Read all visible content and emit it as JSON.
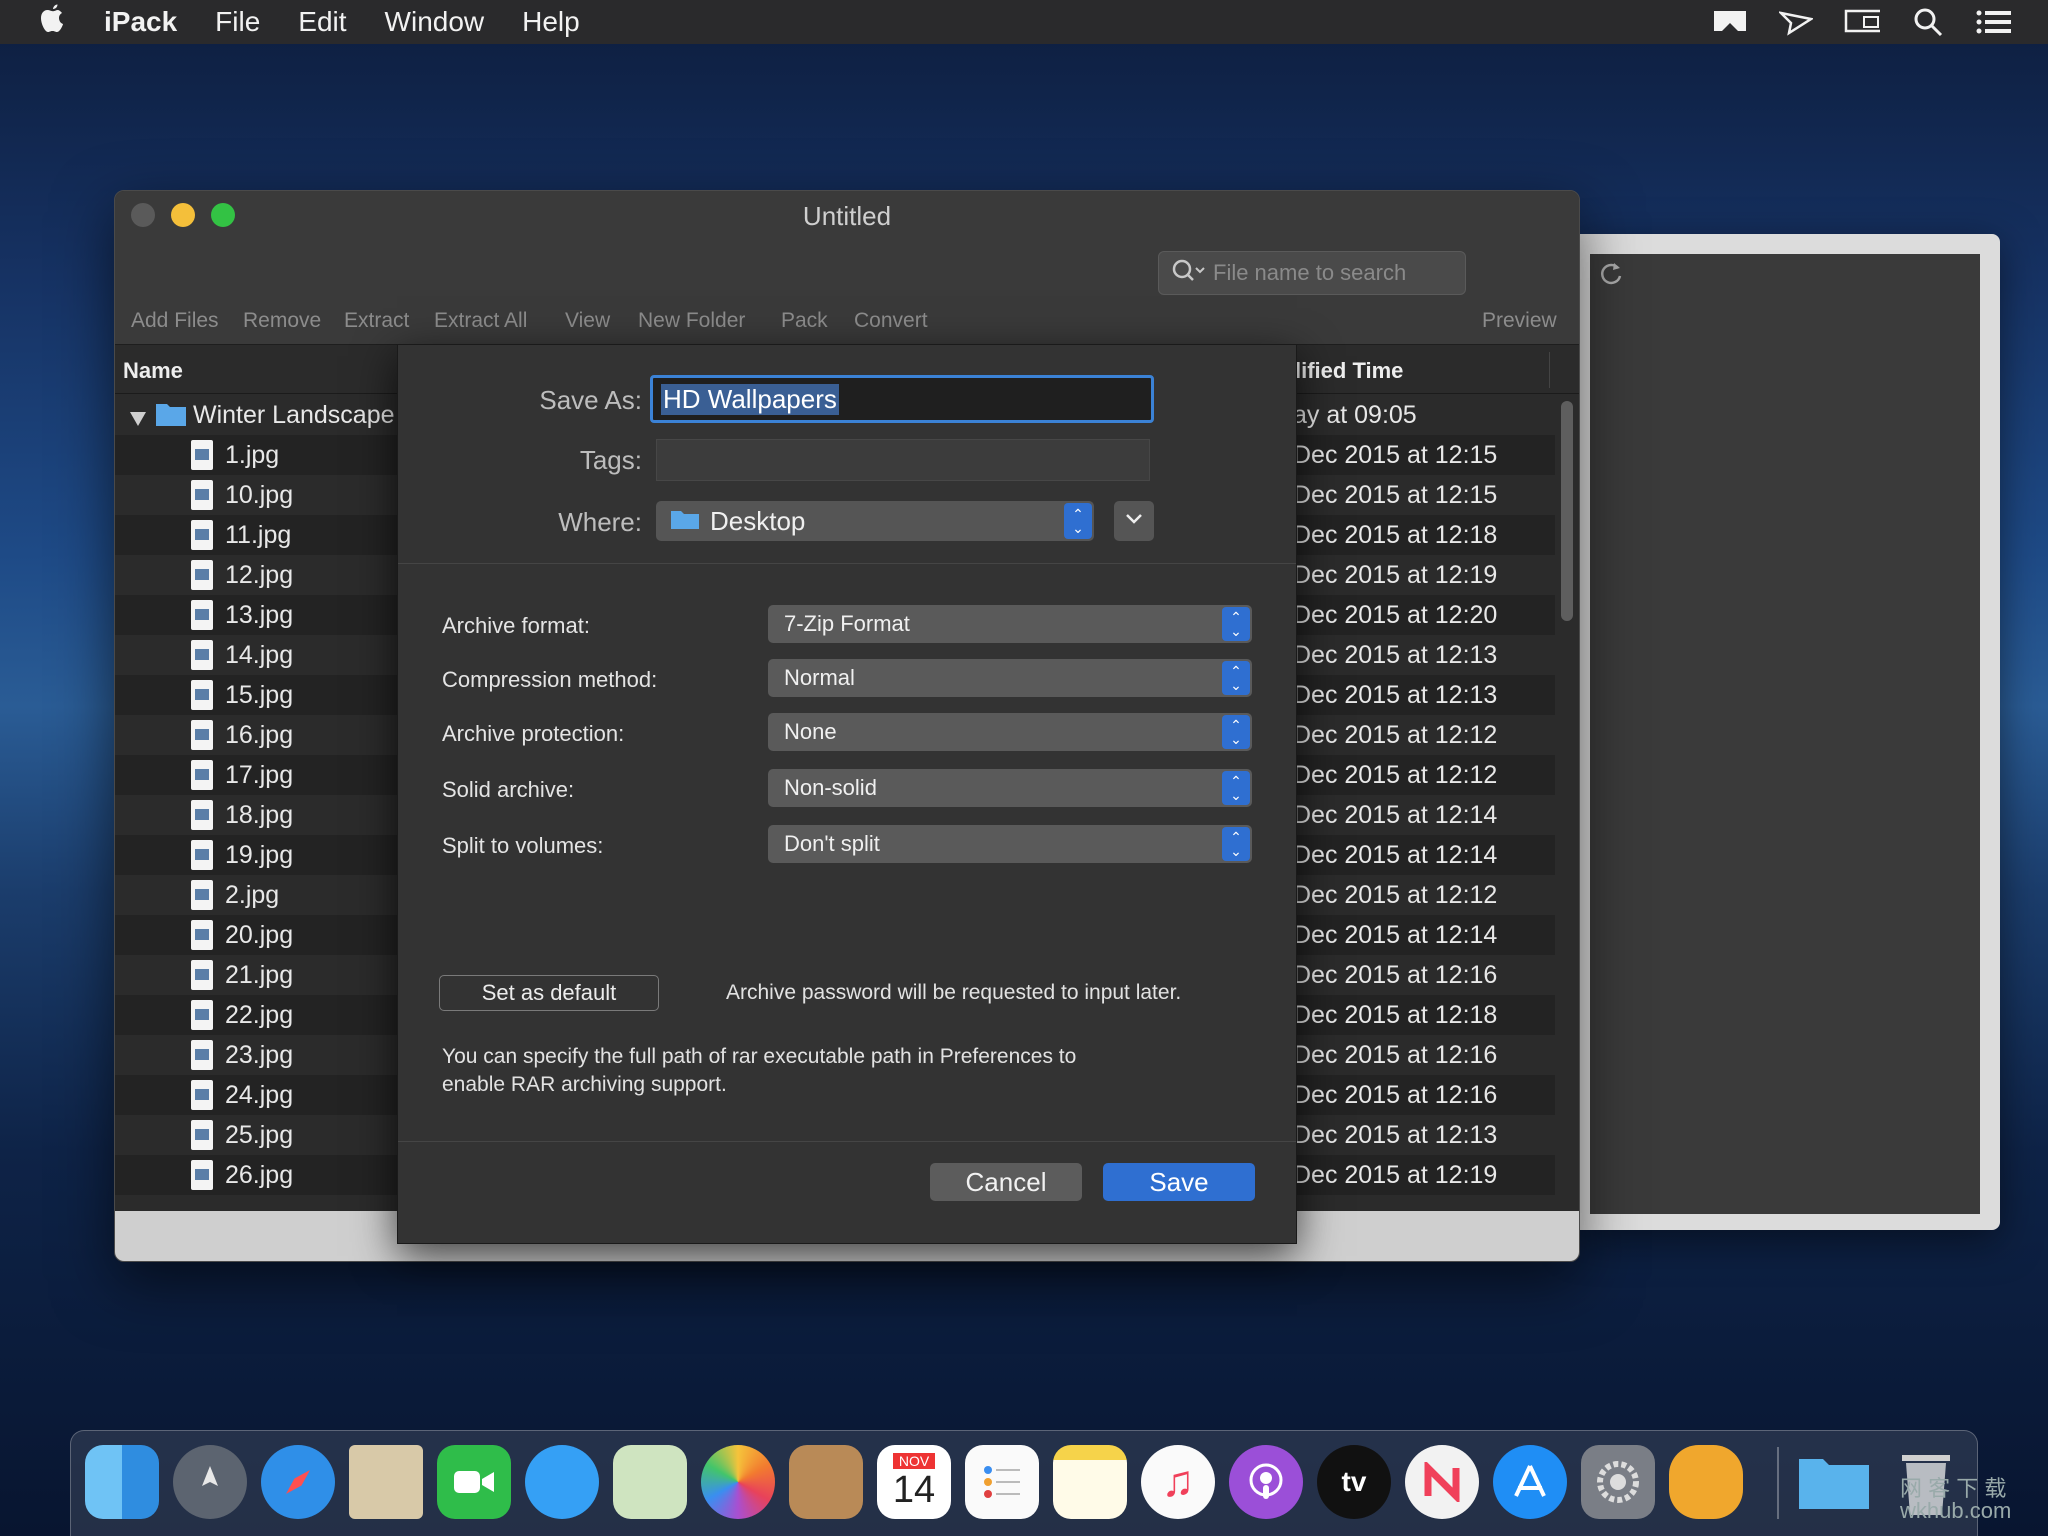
{
  "menubar": {
    "app": "iPack",
    "items": [
      "File",
      "Edit",
      "Window",
      "Help"
    ]
  },
  "window": {
    "title": "Untitled",
    "toolbar": [
      "Add Files",
      "Remove",
      "Extract",
      "Extract All",
      "View",
      "New Folder",
      "Pack",
      "Convert"
    ],
    "preview_label": "Preview",
    "search_placeholder": "File name to search"
  },
  "list": {
    "col_name": "Name",
    "col_time": "lified Time",
    "folder": {
      "name": "Winter Landscape",
      "time": "ay at 09:05"
    },
    "files": [
      {
        "name": "1.jpg",
        "time": "Dec 2015 at 12:15"
      },
      {
        "name": "10.jpg",
        "time": "Dec 2015 at 12:15"
      },
      {
        "name": "11.jpg",
        "time": "Dec 2015 at 12:18"
      },
      {
        "name": "12.jpg",
        "time": "Dec 2015 at 12:19"
      },
      {
        "name": "13.jpg",
        "time": "Dec 2015 at 12:20"
      },
      {
        "name": "14.jpg",
        "time": "Dec 2015 at 12:13"
      },
      {
        "name": "15.jpg",
        "time": "Dec 2015 at 12:13"
      },
      {
        "name": "16.jpg",
        "time": "Dec 2015 at 12:12"
      },
      {
        "name": "17.jpg",
        "time": "Dec 2015 at 12:12"
      },
      {
        "name": "18.jpg",
        "time": "Dec 2015 at 12:14"
      },
      {
        "name": "19.jpg",
        "time": "Dec 2015 at 12:14"
      },
      {
        "name": "2.jpg",
        "time": "Dec 2015 at 12:12"
      },
      {
        "name": "20.jpg",
        "time": "Dec 2015 at 12:14"
      },
      {
        "name": "21.jpg",
        "time": "Dec 2015 at 12:16"
      },
      {
        "name": "22.jpg",
        "time": "Dec 2015 at 12:18"
      },
      {
        "name": "23.jpg",
        "time": "Dec 2015 at 12:16"
      },
      {
        "name": "24.jpg",
        "time": "Dec 2015 at 12:16"
      },
      {
        "name": "25.jpg",
        "time": "Dec 2015 at 12:13"
      },
      {
        "name": "26.jpg",
        "time": "Dec 2015 at 12:19"
      }
    ]
  },
  "sheet": {
    "save_as_label": "Save As:",
    "save_as_value": "HD Wallpapers",
    "tags_label": "Tags:",
    "where_label": "Where:",
    "where_value": "Desktop",
    "options": [
      {
        "label": "Archive format:",
        "value": "7-Zip Format"
      },
      {
        "label": "Compression method:",
        "value": "Normal"
      },
      {
        "label": "Archive protection:",
        "value": "None"
      },
      {
        "label": "Solid archive:",
        "value": "Non-solid"
      },
      {
        "label": "Split to volumes:",
        "value": "Don't split"
      }
    ],
    "default_button": "Set as default",
    "password_note": "Archive password will be requested to input later.",
    "rar_note_1": "You can specify the full path of rar executable path in Preferences to",
    "rar_note_2": "enable RAR archiving support.",
    "cancel": "Cancel",
    "save": "Save"
  },
  "dock": {
    "calendar_month": "NOV",
    "calendar_day": "14",
    "tv_label": "tv"
  },
  "watermark": {
    "line1": "网 客 下 载",
    "line2": "wkhub.com"
  },
  "colors": {
    "accent": "#2f6fd1",
    "window_bg": "#2b2b2b",
    "sheet_bg": "#333333"
  }
}
